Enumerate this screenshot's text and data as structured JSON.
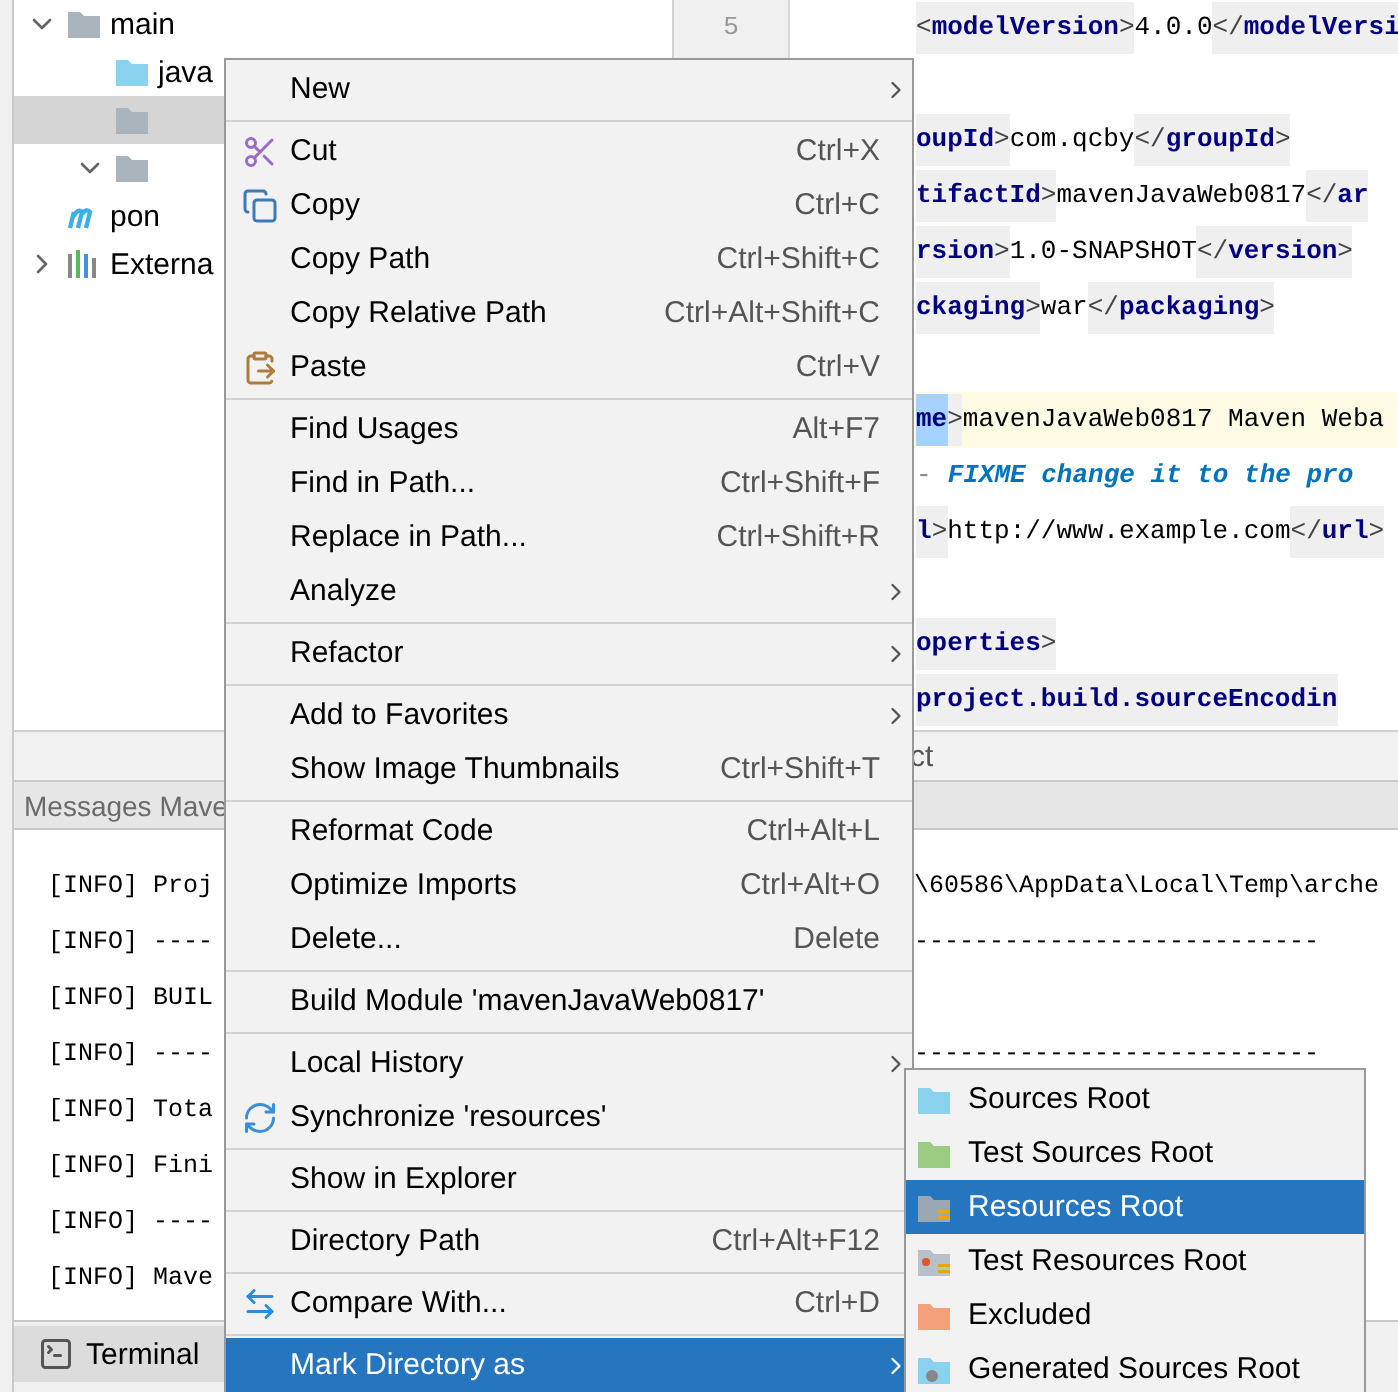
{
  "tree": {
    "items": [
      {
        "label": "main",
        "kind": "folder",
        "expanded": true,
        "selected": false,
        "children": [
          {
            "label": "java",
            "kind": "source-folder",
            "selected": false
          },
          {
            "kind": "folder",
            "selected": true
          },
          {
            "kind": "folder",
            "expanded": true,
            "selected": false
          }
        ]
      },
      {
        "label": "pon",
        "kind": "maven",
        "selected": false
      },
      {
        "label": "Externa",
        "kind": "library",
        "expanded": false,
        "selected": false
      }
    ]
  },
  "gutter": {
    "line_numbers": [
      "5"
    ]
  },
  "editor": {
    "lines": [
      {
        "current": false,
        "tokens": [
          {
            "kind": "punct",
            "text": "<"
          },
          {
            "kind": "tag",
            "text": "modelVersion"
          },
          {
            "kind": "punct",
            "text": ">"
          },
          {
            "kind": "text",
            "text": "4.0.0"
          },
          {
            "kind": "punct",
            "text": "</"
          },
          {
            "kind": "tag",
            "text": "modelVersi"
          }
        ]
      },
      {
        "current": false
      },
      {
        "current": false,
        "tokens": [
          {
            "kind": "tag",
            "text": "oupId"
          },
          {
            "kind": "punct",
            "text": ">"
          },
          {
            "kind": "text",
            "text": "com.qcby"
          },
          {
            "kind": "punct",
            "text": "</"
          },
          {
            "kind": "tag",
            "text": "groupId"
          },
          {
            "kind": "punct",
            "text": ">"
          }
        ]
      },
      {
        "current": false,
        "tokens": [
          {
            "kind": "tag",
            "text": "tifactId"
          },
          {
            "kind": "punct",
            "text": ">"
          },
          {
            "kind": "text",
            "text": "mavenJavaWeb0817"
          },
          {
            "kind": "punct",
            "text": "</"
          },
          {
            "kind": "tag",
            "text": "ar"
          }
        ]
      },
      {
        "current": false,
        "tokens": [
          {
            "kind": "tag",
            "text": "rsion"
          },
          {
            "kind": "punct",
            "text": ">"
          },
          {
            "kind": "text",
            "text": "1.0-SNAPSHOT"
          },
          {
            "kind": "punct",
            "text": "</"
          },
          {
            "kind": "tag",
            "text": "version"
          },
          {
            "kind": "punct",
            "text": ">"
          }
        ]
      },
      {
        "current": false,
        "tokens": [
          {
            "kind": "tag",
            "text": "ckaging"
          },
          {
            "kind": "punct",
            "text": ">"
          },
          {
            "kind": "text",
            "text": "war"
          },
          {
            "kind": "punct",
            "text": "</"
          },
          {
            "kind": "tag",
            "text": "packaging"
          },
          {
            "kind": "punct",
            "text": ">"
          }
        ]
      },
      {
        "current": false
      },
      {
        "current": true,
        "tokens": [
          {
            "kind": "match",
            "text": "me"
          },
          {
            "kind": "punct",
            "text": ">"
          },
          {
            "kind": "text",
            "text": "mavenJavaWeb0817 Maven Weba"
          }
        ]
      },
      {
        "current": false,
        "tokens": [
          {
            "kind": "comment-mark",
            "text": "-"
          },
          {
            "kind": "comment",
            "text": "FIXME change it to the pro"
          }
        ]
      },
      {
        "current": false,
        "tokens": [
          {
            "kind": "tag",
            "text": "l"
          },
          {
            "kind": "punct",
            "text": ">"
          },
          {
            "kind": "text",
            "text": "http://www.example.com"
          },
          {
            "kind": "punct",
            "text": "</"
          },
          {
            "kind": "tag",
            "text": "url"
          },
          {
            "kind": "punct",
            "text": ">"
          }
        ]
      },
      {
        "current": false
      },
      {
        "current": false,
        "tokens": [
          {
            "kind": "tag",
            "text": "operties"
          },
          {
            "kind": "punct",
            "text": ">"
          }
        ]
      },
      {
        "current": false,
        "tokens": [
          {
            "kind": "tag",
            "text": "project.build.sourceEncodin"
          }
        ]
      }
    ]
  },
  "breadcrumb": {
    "text": "ct"
  },
  "tool_window": {
    "title": "Messages Mave",
    "log": [
      {
        "left": "[INFO] Proj",
        "right": "\\60586\\AppData\\Local\\Temp\\arche"
      },
      {
        "left": "[INFO] ----",
        "right": "---------------------------"
      },
      {
        "left": "[INFO] BUIL"
      },
      {
        "left": "[INFO] ----",
        "right": "---------------------------"
      },
      {
        "left": "[INFO] Tota"
      },
      {
        "left": "[INFO] Fini"
      },
      {
        "left": "[INFO] ----"
      },
      {
        "left": "[INFO] Mave"
      }
    ]
  },
  "bottom_bar": {
    "tabs": [
      {
        "label": "Terminal"
      }
    ]
  },
  "menu": {
    "groups": [
      [
        {
          "label": "New",
          "submenu": true,
          "selected": false
        }
      ],
      [
        {
          "label": "Cut",
          "shortcut": "Ctrl+X",
          "kind": "cut",
          "submenu": false,
          "selected": false
        },
        {
          "label": "Copy",
          "shortcut": "Ctrl+C",
          "kind": "copy",
          "submenu": false,
          "selected": false
        },
        {
          "label": "Copy Path",
          "shortcut": "Ctrl+Shift+C",
          "submenu": false,
          "selected": false
        },
        {
          "label": "Copy Relative Path",
          "shortcut": "Ctrl+Alt+Shift+C",
          "submenu": false,
          "selected": false
        },
        {
          "label": "Paste",
          "shortcut": "Ctrl+V",
          "kind": "paste",
          "submenu": false,
          "selected": false
        }
      ],
      [
        {
          "label": "Find Usages",
          "shortcut": "Alt+F7",
          "submenu": false,
          "selected": false
        },
        {
          "label": "Find in Path...",
          "shortcut": "Ctrl+Shift+F",
          "submenu": false,
          "selected": false
        },
        {
          "label": "Replace in Path...",
          "shortcut": "Ctrl+Shift+R",
          "submenu": false,
          "selected": false
        },
        {
          "label": "Analyze",
          "submenu": true,
          "selected": false
        }
      ],
      [
        {
          "label": "Refactor",
          "submenu": true,
          "selected": false
        }
      ],
      [
        {
          "label": "Add to Favorites",
          "submenu": true,
          "selected": false
        },
        {
          "label": "Show Image Thumbnails",
          "shortcut": "Ctrl+Shift+T",
          "submenu": false,
          "selected": false
        }
      ],
      [
        {
          "label": "Reformat Code",
          "shortcut": "Ctrl+Alt+L",
          "submenu": false,
          "selected": false
        },
        {
          "label": "Optimize Imports",
          "shortcut": "Ctrl+Alt+O",
          "submenu": false,
          "selected": false
        },
        {
          "label": "Delete...",
          "shortcut": "Delete",
          "submenu": false,
          "selected": false
        }
      ],
      [
        {
          "label": "Build Module 'mavenJavaWeb0817'",
          "submenu": false,
          "selected": false
        }
      ],
      [
        {
          "label": "Local History",
          "submenu": true,
          "selected": false
        },
        {
          "label": "Synchronize 'resources'",
          "kind": "sync",
          "submenu": false,
          "selected": false
        }
      ],
      [
        {
          "label": "Show in Explorer",
          "submenu": false,
          "selected": false
        }
      ],
      [
        {
          "label": "Directory Path",
          "shortcut": "Ctrl+Alt+F12",
          "submenu": false,
          "selected": false
        }
      ],
      [
        {
          "label": "Compare With...",
          "shortcut": "Ctrl+D",
          "kind": "compare",
          "submenu": false,
          "selected": false
        }
      ],
      [
        {
          "label": "Mark Directory as",
          "submenu": true,
          "selected": true
        }
      ]
    ]
  },
  "submenu": {
    "items": [
      {
        "label": "Sources Root",
        "kind": "sources",
        "selected": false
      },
      {
        "label": "Test Sources Root",
        "kind": "test-sources",
        "selected": false
      },
      {
        "label": "Resources Root",
        "kind": "resources",
        "selected": true
      },
      {
        "label": "Test Resources Root",
        "kind": "test-resources",
        "selected": false
      },
      {
        "label": "Excluded",
        "kind": "excluded",
        "selected": false
      },
      {
        "label": "Generated Sources Root",
        "kind": "generated",
        "selected": false
      }
    ]
  }
}
